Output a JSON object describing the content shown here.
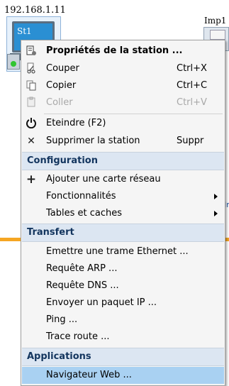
{
  "workspace": {
    "station_ip": "192.168.1.11",
    "station_name": "St1",
    "printer_name": "Imp1",
    "side_fragment": "Ir"
  },
  "menu": {
    "properties": {
      "label": "Propriétés de la station ...",
      "icon": "properties-icon"
    },
    "cut": {
      "label": "Couper",
      "shortcut": "Ctrl+X",
      "icon": "scissors-icon"
    },
    "copy": {
      "label": "Copier",
      "shortcut": "Ctrl+C",
      "icon": "copy-icon"
    },
    "paste": {
      "label": "Coller",
      "shortcut": "Ctrl+V",
      "icon": "paste-icon",
      "enabled": false
    },
    "shutdown": {
      "label": "Eteindre  (F2)",
      "icon": "power-icon"
    },
    "delete": {
      "label": "Supprimer la station",
      "shortcut": "Suppr",
      "icon": "delete-icon"
    },
    "sections": {
      "configuration": "Configuration",
      "transfer": "Transfert",
      "applications": "Applications"
    },
    "config_items": {
      "add_card": {
        "label": "Ajouter une carte réseau",
        "icon": "plus-icon"
      },
      "features": {
        "label": "Fonctionnalités"
      },
      "tables": {
        "label": "Tables et caches"
      }
    },
    "transfer_items": {
      "ethernet": "Emettre une trame Ethernet ...",
      "arp": "Requête ARP ...",
      "dns": "Requête DNS ...",
      "ip": "Envoyer un paquet IP ...",
      "ping": "Ping ...",
      "trace": "Trace route ..."
    },
    "app_items": {
      "browser": "Navigateur Web ..."
    }
  },
  "colors": {
    "highlight": "#a9d1f2",
    "section_bg": "#dce6f2",
    "section_text": "#13355e",
    "link_orange": "#f5a623",
    "monitor_blue": "#2a8fd3"
  }
}
